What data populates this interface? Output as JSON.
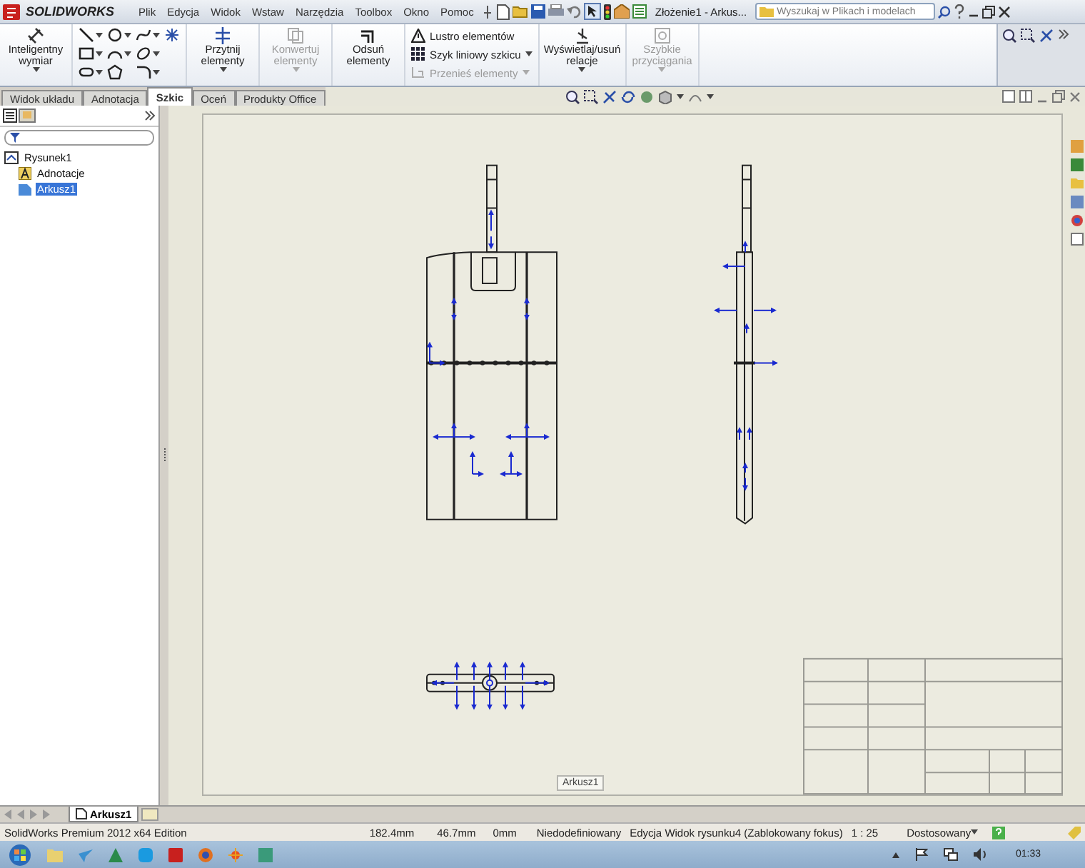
{
  "title_bar": {
    "logo": "SOLIDWORKS",
    "menu": [
      "Plik",
      "Edycja",
      "Widok",
      "Wstaw",
      "Narzędzia",
      "Toolbox",
      "Okno",
      "Pomoc"
    ],
    "document_title": "Złożenie1 - Arkus...",
    "search": {
      "placeholder": "Wyszukaj w Plikach i modelach"
    }
  },
  "ribbon": {
    "groups": [
      {
        "kind": "large",
        "label": "Inteligentny wymiar",
        "dropdown": true,
        "disabled": false
      },
      {
        "kind": "tools"
      },
      {
        "kind": "large",
        "label": "Przytnij elementy",
        "dropdown": true,
        "disabled": false
      },
      {
        "kind": "large",
        "label": "Konwertuj elementy",
        "dropdown": true,
        "disabled": true
      },
      {
        "kind": "large",
        "label": "Odsuń elementy",
        "dropdown": false,
        "disabled": false
      },
      {
        "kind": "stack",
        "items": [
          {
            "label": "Lustro elementów",
            "dropdown": false,
            "disabled": false
          },
          {
            "label": "Szyk liniowy szkicu",
            "dropdown": true,
            "disabled": false
          },
          {
            "label": "Przenieś elementy",
            "dropdown": true,
            "disabled": true
          }
        ]
      },
      {
        "kind": "large",
        "label": "Wyświetlaj/usuń relacje",
        "dropdown": true,
        "disabled": false
      },
      {
        "kind": "large",
        "label": "Szybkie przyciągania",
        "dropdown": true,
        "disabled": true
      }
    ]
  },
  "tabs": [
    {
      "label": "Widok układu",
      "selected": false
    },
    {
      "label": "Adnotacja",
      "selected": false
    },
    {
      "label": "Szkic",
      "selected": true
    },
    {
      "label": "Oceń",
      "selected": false
    },
    {
      "label": "Produkty Office",
      "selected": false
    }
  ],
  "feature_tree": [
    {
      "label": "Rysunek1",
      "selected": false,
      "children": [
        {
          "label": "Adnotacje",
          "selected": false
        },
        {
          "label": "Arkusz1",
          "selected": true
        }
      ]
    }
  ],
  "sheet": {
    "label": "Arkusz1"
  },
  "sheet_tabs": [
    {
      "label": "Arkusz1",
      "selected": true
    }
  ],
  "status_bar": {
    "edition": "SolidWorks Premium 2012 x64 Edition",
    "x": "182.4mm",
    "y": "46.7mm",
    "z": "0mm",
    "state": "Niedodefiniowany",
    "mode": "Edycja Widok rysunku4 (Zablokowany fokus)",
    "scale": "1 : 25",
    "units": "Dostosowany"
  },
  "taskbar": {
    "clock": "01:33"
  }
}
